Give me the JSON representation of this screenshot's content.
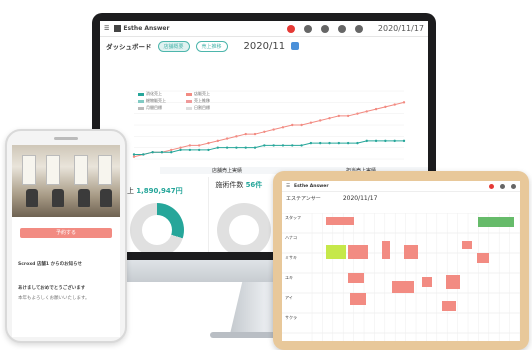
{
  "monitor_app": {
    "brand": "Esthe Answer",
    "date": "2020/11/17",
    "page_title": "ダッシュボード",
    "tabs": [
      "店舗概要",
      "売上推移"
    ],
    "month": "2020/11",
    "legend": [
      "消化売上",
      "店販売上",
      "総物販売上",
      "売上推移",
      "月間目標",
      "日割目標"
    ],
    "section_month": "11月",
    "panel_titles": [
      "店舗売上実績",
      "担当売上実績"
    ],
    "revenue": "1,890,947円",
    "revenue_label": "店舗売上",
    "count_label": "施術件数",
    "count": "56件"
  },
  "phone_app": {
    "button_label": "予約する",
    "heading": "Scroxd 店舗1 からのお知らせ",
    "body_title": "あけましておめでとうございます",
    "body_text": "本年もよろしくお願いいたします。"
  },
  "tablet_app": {
    "brand": "Esthe Answer",
    "store": "エステアンサー",
    "date": "2020/11/17",
    "staff": [
      "スタッフ",
      "ハナコ",
      "ミサキ",
      "ユキ",
      "アイ",
      "サクラ"
    ]
  },
  "colors": {
    "teal": "#26a69a",
    "salmon": "#f28b82",
    "lime": "#c6e84a",
    "green": "#66bb6a"
  },
  "chart_data": {
    "type": "line",
    "series": [
      {
        "values": [
          1,
          2,
          3,
          3,
          4,
          5,
          6,
          6,
          7,
          8,
          9,
          10,
          11,
          11,
          12,
          13,
          14,
          15,
          15,
          16,
          17,
          18,
          19,
          19,
          20,
          21,
          22,
          23,
          24,
          25
        ]
      },
      {
        "values": [
          2,
          2,
          3,
          3,
          3,
          4,
          4,
          4,
          4,
          5,
          5,
          5,
          5,
          5,
          6,
          6,
          6,
          6,
          6,
          7,
          7,
          7,
          7,
          7,
          7,
          8,
          8,
          8,
          8,
          8
        ]
      }
    ],
    "ylim": [
      0,
      30
    ],
    "grid": true
  }
}
